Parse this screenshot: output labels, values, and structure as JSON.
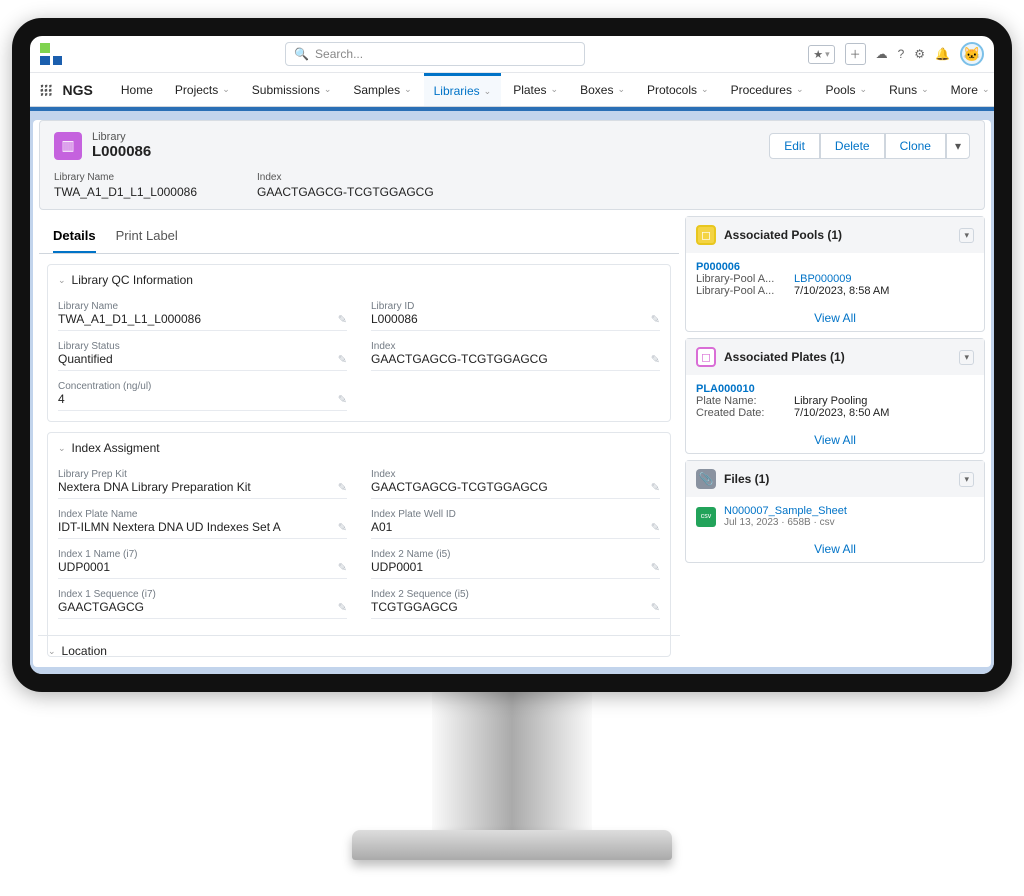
{
  "search_placeholder": "Search...",
  "app_name": "NGS",
  "nav": [
    "Home",
    "Projects",
    "Submissions",
    "Samples",
    "Libraries",
    "Plates",
    "Boxes",
    "Protocols",
    "Procedures",
    "Pools",
    "Runs",
    "More"
  ],
  "nav_active": "Libraries",
  "record": {
    "type": "Library",
    "title": "L000086"
  },
  "actions": {
    "edit": "Edit",
    "delete": "Delete",
    "clone": "Clone"
  },
  "header_fields": {
    "name_label": "Library Name",
    "name_value": "TWA_A1_D1_L1_L000086",
    "index_label": "Index",
    "index_value": "GAACTGAGCG-TCGTGGAGCG"
  },
  "tabs": {
    "details": "Details",
    "print_label": "Print Label"
  },
  "sections": {
    "qc_title": "Library QC Information",
    "idx_title": "Index Assigment",
    "loc_title": "Location"
  },
  "qc": {
    "lib_name_l": "Library Name",
    "lib_name_v": "TWA_A1_D1_L1_L000086",
    "lib_id_l": "Library ID",
    "lib_id_v": "L000086",
    "status_l": "Library Status",
    "status_v": "Quantified",
    "index_l": "Index",
    "index_v": "GAACTGAGCG-TCGTGGAGCG",
    "conc_l": "Concentration (ng/ul)",
    "conc_v": "4"
  },
  "idx": {
    "prep_l": "Library Prep Kit",
    "prep_v": "Nextera DNA Library Preparation Kit",
    "index_l": "Index",
    "index_v": "GAACTGAGCG-TCGTGGAGCG",
    "plate_name_l": "Index Plate Name",
    "plate_name_v": "IDT-ILMN Nextera DNA UD Indexes Set A",
    "well_l": "Index Plate Well ID",
    "well_v": "A01",
    "i1n_l": "Index 1 Name (i7)",
    "i1n_v": "UDP0001",
    "i2n_l": "Index 2 Name (i5)",
    "i2n_v": "UDP0001",
    "i1s_l": "Index 1 Sequence (i7)",
    "i1s_v": "GAACTGAGCG",
    "i2s_l": "Index 2 Sequence (i5)",
    "i2s_v": "TCGTGGAGCG"
  },
  "pools": {
    "title": "Associated Pools (1)",
    "link": "P000006",
    "row1_k": "Library-Pool A...",
    "row1_v": "LBP000009",
    "row2_k": "Library-Pool A...",
    "row2_v": "7/10/2023, 8:58 AM",
    "view_all": "View All"
  },
  "plates": {
    "title": "Associated Plates (1)",
    "link": "PLA000010",
    "row1_k": "Plate Name:",
    "row1_v": "Library Pooling",
    "row2_k": "Created Date:",
    "row2_v": "7/10/2023, 8:50 AM",
    "view_all": "View All"
  },
  "files": {
    "title": "Files (1)",
    "name": "N000007_Sample_Sheet",
    "meta": "Jul 13, 2023 · 658B · csv",
    "view_all": "View All"
  }
}
